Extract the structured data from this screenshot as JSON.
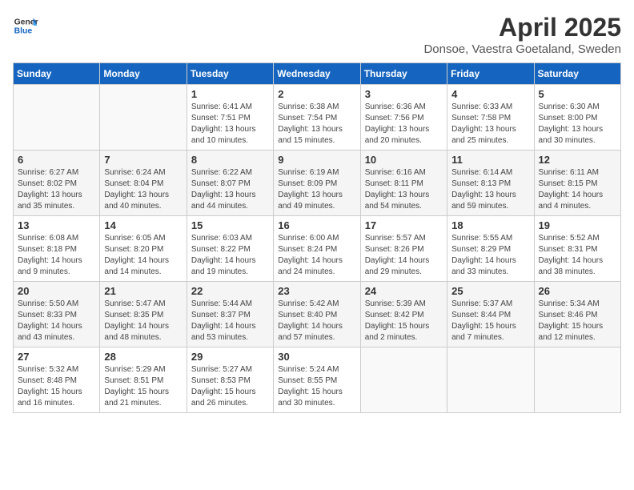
{
  "logo": {
    "line1": "General",
    "line2": "Blue"
  },
  "title": "April 2025",
  "subtitle": "Donsoe, Vaestra Goetaland, Sweden",
  "days_of_week": [
    "Sunday",
    "Monday",
    "Tuesday",
    "Wednesday",
    "Thursday",
    "Friday",
    "Saturday"
  ],
  "weeks": [
    [
      {
        "day": "",
        "info": ""
      },
      {
        "day": "",
        "info": ""
      },
      {
        "day": "1",
        "info": "Sunrise: 6:41 AM\nSunset: 7:51 PM\nDaylight: 13 hours and 10 minutes."
      },
      {
        "day": "2",
        "info": "Sunrise: 6:38 AM\nSunset: 7:54 PM\nDaylight: 13 hours and 15 minutes."
      },
      {
        "day": "3",
        "info": "Sunrise: 6:36 AM\nSunset: 7:56 PM\nDaylight: 13 hours and 20 minutes."
      },
      {
        "day": "4",
        "info": "Sunrise: 6:33 AM\nSunset: 7:58 PM\nDaylight: 13 hours and 25 minutes."
      },
      {
        "day": "5",
        "info": "Sunrise: 6:30 AM\nSunset: 8:00 PM\nDaylight: 13 hours and 30 minutes."
      }
    ],
    [
      {
        "day": "6",
        "info": "Sunrise: 6:27 AM\nSunset: 8:02 PM\nDaylight: 13 hours and 35 minutes."
      },
      {
        "day": "7",
        "info": "Sunrise: 6:24 AM\nSunset: 8:04 PM\nDaylight: 13 hours and 40 minutes."
      },
      {
        "day": "8",
        "info": "Sunrise: 6:22 AM\nSunset: 8:07 PM\nDaylight: 13 hours and 44 minutes."
      },
      {
        "day": "9",
        "info": "Sunrise: 6:19 AM\nSunset: 8:09 PM\nDaylight: 13 hours and 49 minutes."
      },
      {
        "day": "10",
        "info": "Sunrise: 6:16 AM\nSunset: 8:11 PM\nDaylight: 13 hours and 54 minutes."
      },
      {
        "day": "11",
        "info": "Sunrise: 6:14 AM\nSunset: 8:13 PM\nDaylight: 13 hours and 59 minutes."
      },
      {
        "day": "12",
        "info": "Sunrise: 6:11 AM\nSunset: 8:15 PM\nDaylight: 14 hours and 4 minutes."
      }
    ],
    [
      {
        "day": "13",
        "info": "Sunrise: 6:08 AM\nSunset: 8:18 PM\nDaylight: 14 hours and 9 minutes."
      },
      {
        "day": "14",
        "info": "Sunrise: 6:05 AM\nSunset: 8:20 PM\nDaylight: 14 hours and 14 minutes."
      },
      {
        "day": "15",
        "info": "Sunrise: 6:03 AM\nSunset: 8:22 PM\nDaylight: 14 hours and 19 minutes."
      },
      {
        "day": "16",
        "info": "Sunrise: 6:00 AM\nSunset: 8:24 PM\nDaylight: 14 hours and 24 minutes."
      },
      {
        "day": "17",
        "info": "Sunrise: 5:57 AM\nSunset: 8:26 PM\nDaylight: 14 hours and 29 minutes."
      },
      {
        "day": "18",
        "info": "Sunrise: 5:55 AM\nSunset: 8:29 PM\nDaylight: 14 hours and 33 minutes."
      },
      {
        "day": "19",
        "info": "Sunrise: 5:52 AM\nSunset: 8:31 PM\nDaylight: 14 hours and 38 minutes."
      }
    ],
    [
      {
        "day": "20",
        "info": "Sunrise: 5:50 AM\nSunset: 8:33 PM\nDaylight: 14 hours and 43 minutes."
      },
      {
        "day": "21",
        "info": "Sunrise: 5:47 AM\nSunset: 8:35 PM\nDaylight: 14 hours and 48 minutes."
      },
      {
        "day": "22",
        "info": "Sunrise: 5:44 AM\nSunset: 8:37 PM\nDaylight: 14 hours and 53 minutes."
      },
      {
        "day": "23",
        "info": "Sunrise: 5:42 AM\nSunset: 8:40 PM\nDaylight: 14 hours and 57 minutes."
      },
      {
        "day": "24",
        "info": "Sunrise: 5:39 AM\nSunset: 8:42 PM\nDaylight: 15 hours and 2 minutes."
      },
      {
        "day": "25",
        "info": "Sunrise: 5:37 AM\nSunset: 8:44 PM\nDaylight: 15 hours and 7 minutes."
      },
      {
        "day": "26",
        "info": "Sunrise: 5:34 AM\nSunset: 8:46 PM\nDaylight: 15 hours and 12 minutes."
      }
    ],
    [
      {
        "day": "27",
        "info": "Sunrise: 5:32 AM\nSunset: 8:48 PM\nDaylight: 15 hours and 16 minutes."
      },
      {
        "day": "28",
        "info": "Sunrise: 5:29 AM\nSunset: 8:51 PM\nDaylight: 15 hours and 21 minutes."
      },
      {
        "day": "29",
        "info": "Sunrise: 5:27 AM\nSunset: 8:53 PM\nDaylight: 15 hours and 26 minutes."
      },
      {
        "day": "30",
        "info": "Sunrise: 5:24 AM\nSunset: 8:55 PM\nDaylight: 15 hours and 30 minutes."
      },
      {
        "day": "",
        "info": ""
      },
      {
        "day": "",
        "info": ""
      },
      {
        "day": "",
        "info": ""
      }
    ]
  ]
}
